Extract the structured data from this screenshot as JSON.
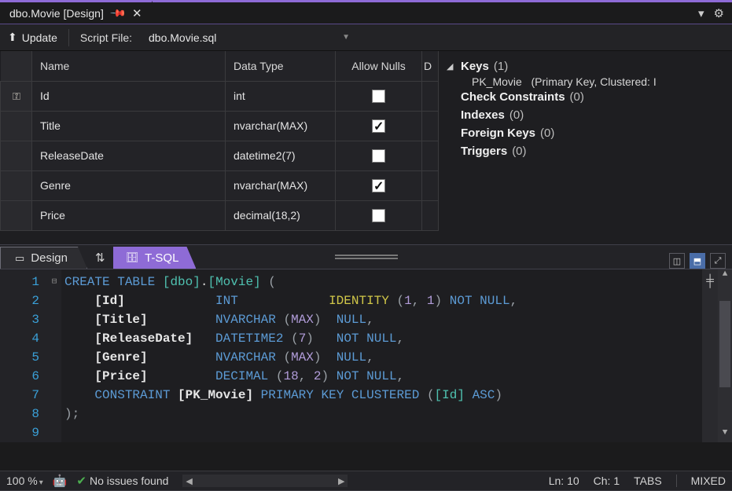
{
  "tab": {
    "title": "dbo.Movie [Design]"
  },
  "toolbar": {
    "update_label": "Update",
    "scriptfile_label": "Script File:",
    "scriptfile_value": "dbo.Movie.sql"
  },
  "grid": {
    "headers": {
      "name": "Name",
      "datatype": "Data Type",
      "allownulls": "Allow Nulls",
      "default": "D"
    },
    "rows": [
      {
        "key": true,
        "name": "Id",
        "type": "int",
        "nulls": false
      },
      {
        "key": false,
        "name": "Title",
        "type": "nvarchar(MAX)",
        "nulls": true
      },
      {
        "key": false,
        "name": "ReleaseDate",
        "type": "datetime2(7)",
        "nulls": false
      },
      {
        "key": false,
        "name": "Genre",
        "type": "nvarchar(MAX)",
        "nulls": true
      },
      {
        "key": false,
        "name": "Price",
        "type": "decimal(18,2)",
        "nulls": false
      }
    ]
  },
  "tree": {
    "keys_label": "Keys",
    "keys_count": "(1)",
    "pk_name": "PK_Movie",
    "pk_desc": "(Primary Key, Clustered: I",
    "check_label": "Check Constraints",
    "check_count": "(0)",
    "indexes_label": "Indexes",
    "indexes_count": "(0)",
    "fk_label": "Foreign Keys",
    "fk_count": "(0)",
    "triggers_label": "Triggers",
    "triggers_count": "(0)"
  },
  "viewtabs": {
    "design": "Design",
    "tsql": "T-SQL"
  },
  "code": {
    "lines": [
      "1",
      "2",
      "3",
      "4",
      "5",
      "6",
      "7",
      "8",
      "9"
    ],
    "kw_create": "CREATE",
    "kw_table": "TABLE",
    "schema": "[dbo]",
    "dot": ".",
    "tbl": "[Movie]",
    "col_id": "[Id]",
    "t_int": "INT",
    "kw_identity": "IDENTITY",
    "one_a": "1",
    "one_b": "1",
    "nn": "NOT NULL",
    "col_title": "[Title]",
    "t_nvarchar": "NVARCHAR",
    "max1": "MAX",
    "null": "NULL",
    "col_rd": "[ReleaseDate]",
    "t_dt2": "DATETIME2",
    "seven": "7",
    "col_genre": "[Genre]",
    "max2": "MAX",
    "col_price": "[Price]",
    "t_dec": "DECIMAL",
    "eighteen": "18",
    "two": "2",
    "kw_constraint": "CONSTRAINT",
    "pk": "[PK_Movie]",
    "kw_pk": "PRIMARY",
    "kw_key": "KEY",
    "kw_clus": "CLUSTERED",
    "idref": "[Id]",
    "kw_asc": "ASC"
  },
  "status": {
    "zoom": "100 %",
    "issues": "No issues found",
    "ln_label": "Ln:",
    "ln_val": "10",
    "ch_label": "Ch:",
    "ch_val": "1",
    "tabs": "TABS",
    "mixed": "MIXED"
  }
}
